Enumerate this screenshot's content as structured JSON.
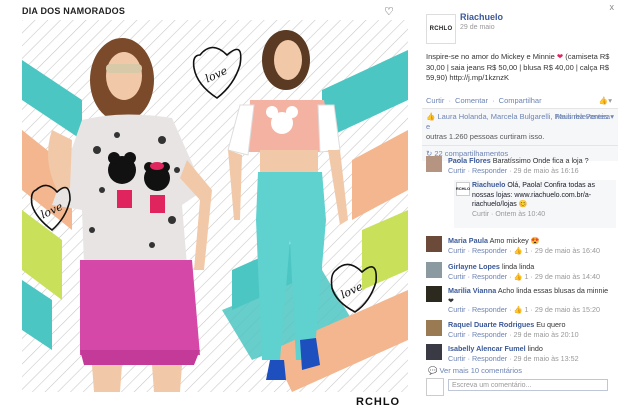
{
  "photo": {
    "caption": "DIA DOS NAMORADOS",
    "brand": "RCHLO",
    "heart_icon": "heart-outline-icon",
    "doodle_word": "love"
  },
  "post": {
    "logo_text": "RCHLO",
    "page_name": "Riachuelo",
    "date": "29 de maio",
    "text_1": "Inspire-se no amor do Mickey e Minnie",
    "heart": "❤",
    "text_2": "(camiseta R$ 30,00 | saia jeans R$ 50,00 | blusa R$ 40,00 | calça R$ 59,90) http://j.mp/1kznzK",
    "actions": [
      "Curtir",
      "Comentar",
      "Compartilhar"
    ],
    "separator": "·",
    "like_thumb_icon": "thumbs-up-icon"
  },
  "likes": {
    "line_1": "Laura Holanda, Marcela Bulgarelli, Paulinha Pereira e",
    "line_2": "outras 1.260 pessoas curtiram isso.",
    "sort": "Mais relevantes ▾",
    "shares": "22 compartilhamentos"
  },
  "comments": [
    {
      "name": "Paola Flores",
      "text": "Baratíssimo Onde fica a loja ?",
      "actions": "Curtir · Responder",
      "time": " · 29 de maio às 16:16"
    },
    {
      "name": "Maria Paula",
      "text": "Amo mickey 😍",
      "actions": "Curtir · Responder",
      "time": " · 👍 1 · 29 de maio às 16:40"
    },
    {
      "name": "Girlayne Lopes",
      "text": "linda linda",
      "actions": "Curtir · Responder",
      "time": " · 👍 1 · 29 de maio às 14:40"
    },
    {
      "name": "Marilia Vianna",
      "text": "Acho linda essas blusas da minnie ❤",
      "actions": "Curtir · Responder",
      "time": " · 👍 1 · 29 de maio às 15:20"
    },
    {
      "name": "Raquel Duarte Rodrigues",
      "text": "Eu quero",
      "actions": "Curtir · Responder",
      "time": " · 29 de maio às 20:10"
    },
    {
      "name": "Isabelly Alencar Fumel",
      "text": "lindo",
      "actions": "Curtir · Responder",
      "time": " · 29 de maio às 13:52"
    }
  ],
  "reply": {
    "logo_text": "RCHLO",
    "name": "Riachuelo",
    "text": "Olá, Paola! Confira todas as nossas lojas: www.riachuelo.com.br/a-riachuelo/lojas",
    "emoji": "😊",
    "actions": "Curtir · Ontem às 10:40"
  },
  "more_comments": "Ver mais 10 comentários",
  "composer_placeholder": "Escreva um comentário...",
  "close": "x"
}
